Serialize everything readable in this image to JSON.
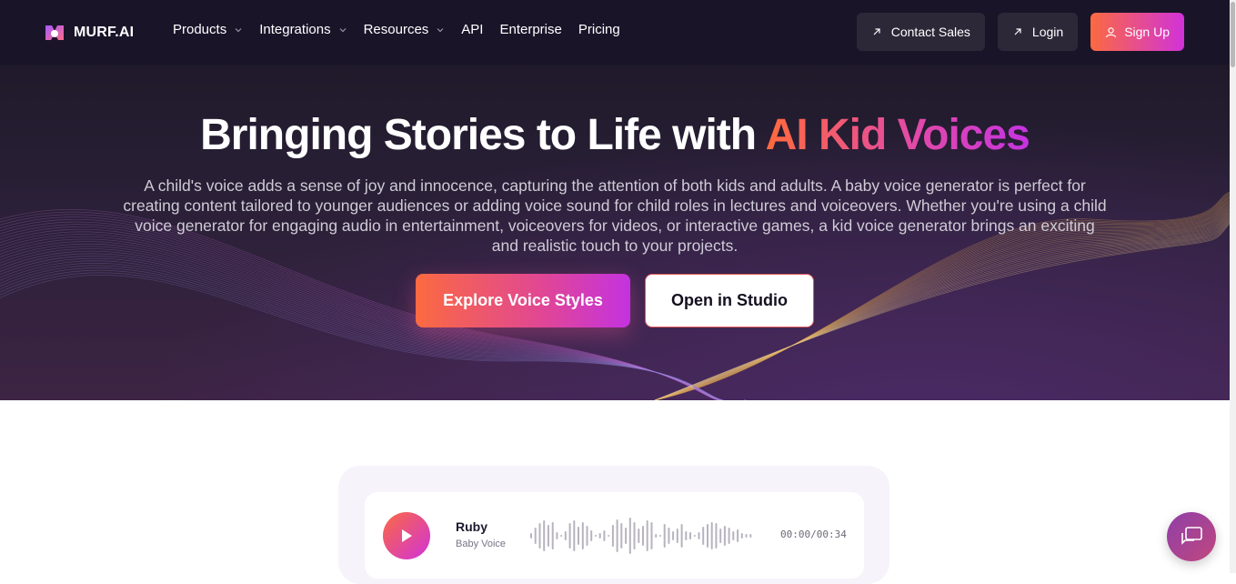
{
  "brand": {
    "name": "MURF.AI"
  },
  "nav": {
    "items": [
      {
        "label": "Products",
        "has_dropdown": true
      },
      {
        "label": "Integrations",
        "has_dropdown": true
      },
      {
        "label": "Resources",
        "has_dropdown": true
      },
      {
        "label": "API",
        "has_dropdown": false
      },
      {
        "label": "Enterprise",
        "has_dropdown": false
      },
      {
        "label": "Pricing",
        "has_dropdown": false
      }
    ],
    "contact_sales": "Contact Sales",
    "login": "Login",
    "signup": "Sign Up"
  },
  "hero": {
    "title_plain": "Bringing Stories to Life with ",
    "title_accent": "AI Kid Voices",
    "subtitle": "A child's voice adds a sense of joy and innocence, capturing the attention of both kids and adults. A baby voice generator is perfect for creating content tailored to younger audiences or adding voice sound for child roles in lectures and voiceovers. Whether you're using a child voice generator for engaging audio in entertainment, voiceovers for videos, or interactive games, a kid voice generator brings an exciting and realistic touch to your projects.",
    "cta_primary": "Explore Voice Styles",
    "cta_secondary": "Open in Studio"
  },
  "player": {
    "voice_name": "Ruby",
    "voice_style": "Baby Voice",
    "time": "00:00/00:34"
  },
  "icons": {
    "contact_sales": "arrow-up-right-icon",
    "login": "arrow-up-right-icon",
    "signup": "user-icon",
    "play": "play-icon",
    "chat": "chat-icon",
    "dropdown": "chevron-down-icon"
  },
  "colors": {
    "nav_bg": "#1a1429",
    "accent_start": "#fb6a41",
    "accent_end": "#d132d9"
  }
}
